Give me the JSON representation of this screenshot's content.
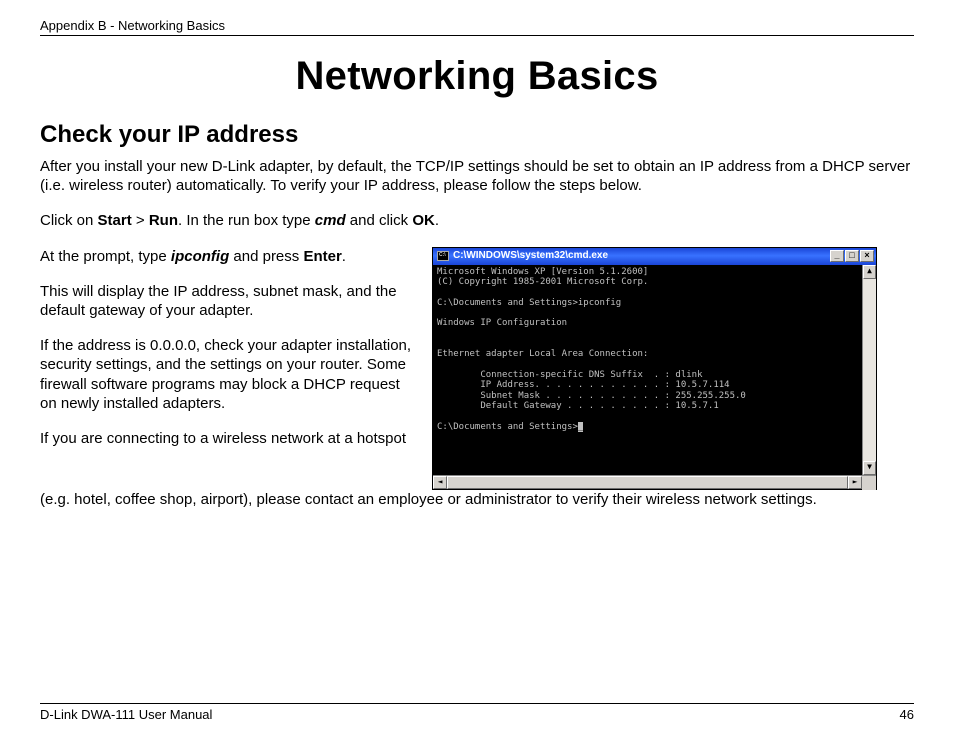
{
  "header": {
    "appendix": "Appendix B - Networking Basics"
  },
  "title": "Networking Basics",
  "section": {
    "heading": "Check your IP address"
  },
  "paras": {
    "intro": "After you install your new D-Link adapter, by default, the TCP/IP settings should be set to obtain an IP address from a DHCP server (i.e. wireless router) automatically. To verify your IP address, please follow the steps below.",
    "click_pre": "Click on ",
    "start": "Start",
    "gt": " > ",
    "run": "Run",
    "click_mid": ". In the run box type ",
    "cmd": "cmd",
    "click_post": " and click ",
    "ok": "OK",
    "period": ".",
    "prompt_pre": "At the prompt, type ",
    "ipconfig": "ipconfig",
    "prompt_post": " and press ",
    "enter": "Enter",
    "display": "This will display the IP address, subnet mask, and the default gateway of your adapter.",
    "zero": "If the address is 0.0.0.0, check your adapter installation, security settings, and the settings on your router. Some firewall software programs may block a DHCP request on newly installed adapters.",
    "hotspot1": "If you are connecting to a wireless network at a hotspot",
    "hotspot2": "(e.g. hotel, coffee shop, airport), please contact an employee or administrator to verify their wireless network settings."
  },
  "cmd_window": {
    "title": "C:\\WINDOWS\\system32\\cmd.exe",
    "lines": {
      "l1": "Microsoft Windows XP [Version 5.1.2600]",
      "l2": "(C) Copyright 1985-2001 Microsoft Corp.",
      "l3": "",
      "l4": "C:\\Documents and Settings>ipconfig",
      "l5": "",
      "l6": "Windows IP Configuration",
      "l7": "",
      "l8": "",
      "l9": "Ethernet adapter Local Area Connection:",
      "l10": "",
      "l11": "        Connection-specific DNS Suffix  . : dlink",
      "l12": "        IP Address. . . . . . . . . . . . : 10.5.7.114",
      "l13": "        Subnet Mask . . . . . . . . . . . : 255.255.255.0",
      "l14": "        Default Gateway . . . . . . . . . : 10.5.7.1",
      "l15": "",
      "l16": "C:\\Documents and Settings>",
      "cursor": "_"
    },
    "btn_min": "_",
    "btn_max": "□",
    "btn_close": "×",
    "arrow_up": "▲",
    "arrow_down": "▼",
    "arrow_left": "◄",
    "arrow_right": "►"
  },
  "footer": {
    "manual": "D-Link DWA-111 User Manual",
    "page": "46"
  }
}
